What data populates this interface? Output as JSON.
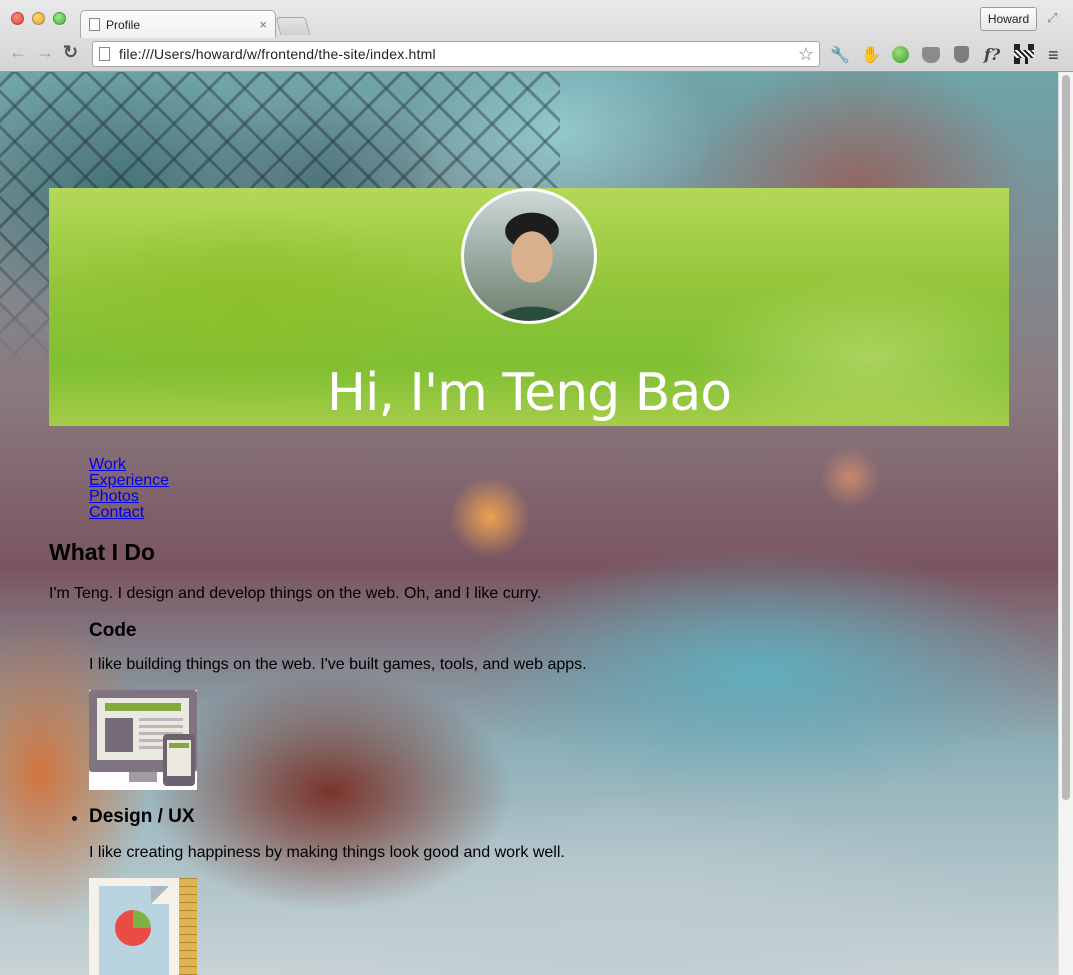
{
  "browser": {
    "tab_title": "Profile",
    "tab_close": "×",
    "user_button": "Howard",
    "url": "file:///Users/howard/w/frontend/the-site/index.html",
    "icons": [
      "back-arrow-icon",
      "forward-arrow-icon",
      "reload-icon",
      "bookmark-star-icon",
      "wrench-icon",
      "evernote-icon",
      "globe-icon",
      "pocket-icon",
      "shield-icon",
      "font-detect-icon",
      "qr-code-icon",
      "menu-icon"
    ]
  },
  "hero": {
    "title": "Hi, I'm Teng Bao"
  },
  "nav": {
    "items": [
      "Work",
      "Experience",
      "Photos",
      "Contact"
    ]
  },
  "what_i_do": {
    "heading": "What I Do",
    "intro": "I'm Teng. I design and develop things on the web. Oh, and I like curry.",
    "skills": [
      {
        "title": "Code",
        "text": "I like building things on the web. I've built games, tools, and web apps."
      },
      {
        "title": "Design / UX",
        "text": "I like creating happiness by making things look good and work well."
      }
    ]
  },
  "colors": {
    "link": "#0000ee",
    "hero_green": "#94c63a",
    "text": "#000000"
  }
}
